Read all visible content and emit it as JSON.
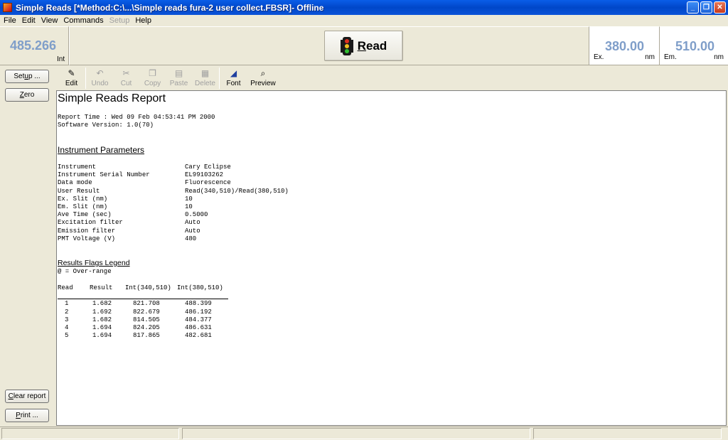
{
  "window": {
    "title": "Simple Reads [*Method:C:\\...\\Simple reads fura-2 user collect.FBSR]- Offline",
    "minimize": "_",
    "restore": "❐",
    "close": "✕"
  },
  "menu": [
    {
      "label": "File",
      "enabled": true
    },
    {
      "label": "Edit",
      "enabled": true
    },
    {
      "label": "View",
      "enabled": true
    },
    {
      "label": "Commands",
      "enabled": true
    },
    {
      "label": "Setup",
      "enabled": false
    },
    {
      "label": "Help",
      "enabled": true
    }
  ],
  "readout": {
    "intensity": "485.266",
    "intensity_unit": "Int",
    "read_label_u": "R",
    "read_label_rest": "ead",
    "ex_value": "380.00",
    "ex_label": "Ex.",
    "ex_unit": "nm",
    "em_value": "510.00",
    "em_label": "Em.",
    "em_unit": "nm"
  },
  "sidebar": {
    "setup_u": "Set",
    "setup_ul": "u",
    "setup_rest": "p ...",
    "zero_u": "Z",
    "zero_rest": "ero",
    "clear_u": "C",
    "clear_rest": "lear report",
    "print_u": "P",
    "print_rest": "rint ..."
  },
  "toolbar": [
    {
      "label": "Edit",
      "icon": "edit-icon",
      "enabled": true
    },
    {
      "label": "Undo",
      "icon": "undo-icon",
      "enabled": false
    },
    {
      "label": "Cut",
      "icon": "cut-icon",
      "enabled": false
    },
    {
      "label": "Copy",
      "icon": "copy-icon",
      "enabled": false
    },
    {
      "label": "Paste",
      "icon": "paste-icon",
      "enabled": false
    },
    {
      "label": "Delete",
      "icon": "delete-icon",
      "enabled": false
    },
    {
      "label": "Font",
      "icon": "font-icon",
      "enabled": true
    },
    {
      "label": "Preview",
      "icon": "preview-icon",
      "enabled": true
    }
  ],
  "report": {
    "title": "Simple Reads Report",
    "report_time": "Report Time : Wed 09 Feb 04:53:41 PM 2000",
    "software_version": "Software Version: 1.0(70)",
    "instrument_heading": "Instrument Parameters",
    "parameters": [
      {
        "key": "Instrument",
        "value": "Cary Eclipse"
      },
      {
        "key": "Instrument Serial Number",
        "value": "EL99103262"
      },
      {
        "key": "Data mode",
        "value": "Fluorescence"
      },
      {
        "key": "User Result",
        "value": "Read(340,510)/Read(380,510)"
      },
      {
        "key": "Ex. Slit (nm)",
        "value": "10"
      },
      {
        "key": "Em. Slit (nm)",
        "value": "10"
      },
      {
        "key": "Ave Time (sec)",
        "value": "0.5000"
      },
      {
        "key": "Excitation filter",
        "value": "Auto"
      },
      {
        "key": "Emission filter",
        "value": "Auto"
      },
      {
        "key": "PMT Voltage (V)",
        "value": "480"
      }
    ],
    "flags_heading": "Results Flags Legend",
    "flags_line": "@ = Over-range",
    "table_header": [
      "Read",
      "Result",
      "Int(340,510)",
      "Int(380,510)"
    ],
    "rows": [
      [
        "1",
        "1.682",
        "821.708",
        "488.399"
      ],
      [
        "2",
        "1.692",
        "822.679",
        "486.192"
      ],
      [
        "3",
        "1.682",
        "814.505",
        "484.377"
      ],
      [
        "4",
        "1.694",
        "824.205",
        "486.631"
      ],
      [
        "5",
        "1.694",
        "817.865",
        "482.681"
      ]
    ]
  }
}
